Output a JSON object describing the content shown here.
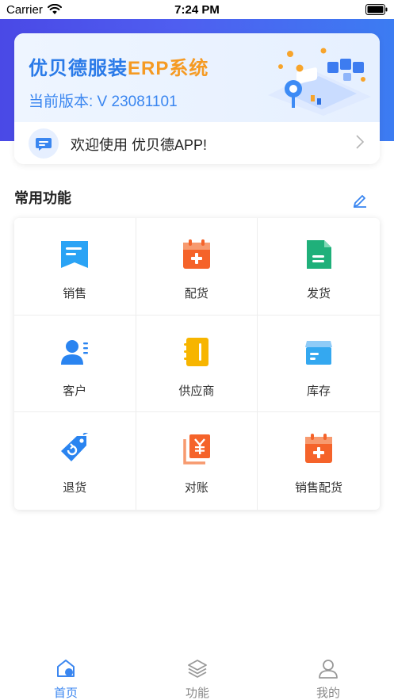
{
  "status_bar": {
    "carrier": "Carrier",
    "time": "7:24 PM"
  },
  "banner": {
    "title_main": "优贝德服装",
    "title_accent": "ERP系统",
    "version": "当前版本: V 23081101"
  },
  "notice": {
    "text": "欢迎使用 优贝德APP!"
  },
  "section": {
    "title": "常用功能"
  },
  "functions": [
    {
      "label": "销售",
      "icon": "sales-bookmark-icon",
      "color": "#2aa3f5"
    },
    {
      "label": "配货",
      "icon": "distribution-calendar-plus-icon",
      "color": "#f5632a"
    },
    {
      "label": "发货",
      "icon": "shipping-document-icon",
      "color": "#1fb07a"
    },
    {
      "label": "客户",
      "icon": "customer-contact-icon",
      "color": "#2a84f0"
    },
    {
      "label": "供应商",
      "icon": "supplier-notebook-icon",
      "color": "#f7b500"
    },
    {
      "label": "库存",
      "icon": "inventory-box-icon",
      "color": "#34a8f0"
    },
    {
      "label": "退货",
      "icon": "return-tag-icon",
      "color": "#2a84f0"
    },
    {
      "label": "对账",
      "icon": "reconciliation-yen-icon",
      "color": "#f5632a"
    },
    {
      "label": "销售配货",
      "icon": "sales-distribution-calendar-icon",
      "color": "#f5632a"
    }
  ],
  "tabbar": {
    "items": [
      {
        "label": "首页",
        "icon": "home-icon"
      },
      {
        "label": "功能",
        "icon": "layers-icon"
      },
      {
        "label": "我的",
        "icon": "profile-icon"
      }
    ],
    "active_color": "#3a86f0",
    "inactive_color": "#888888"
  }
}
